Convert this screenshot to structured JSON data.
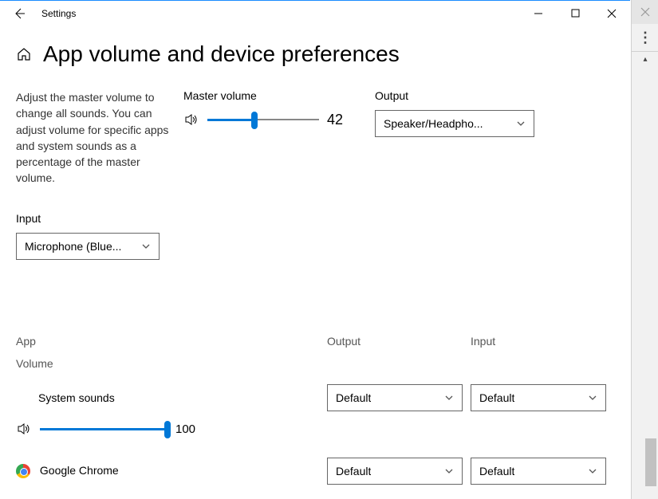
{
  "window": {
    "title": "Settings"
  },
  "page": {
    "title": "App volume and device preferences",
    "description": "Adjust the master volume to change all sounds. You can adjust volume for specific apps and system sounds as a percentage of the master volume."
  },
  "master": {
    "label": "Master volume",
    "value": 42
  },
  "output": {
    "label": "Output",
    "selected": "Speaker/Headpho..."
  },
  "input": {
    "label": "Input",
    "selected": "Microphone (Blue..."
  },
  "appSection": {
    "colApp": "App",
    "colOutput": "Output",
    "colInput": "Input",
    "volumeLabel": "Volume"
  },
  "apps": {
    "system": {
      "name": "System sounds",
      "output": "Default",
      "input": "Default",
      "volume": 100
    },
    "chrome": {
      "name": "Google Chrome",
      "output": "Default",
      "input": "Default"
    }
  }
}
